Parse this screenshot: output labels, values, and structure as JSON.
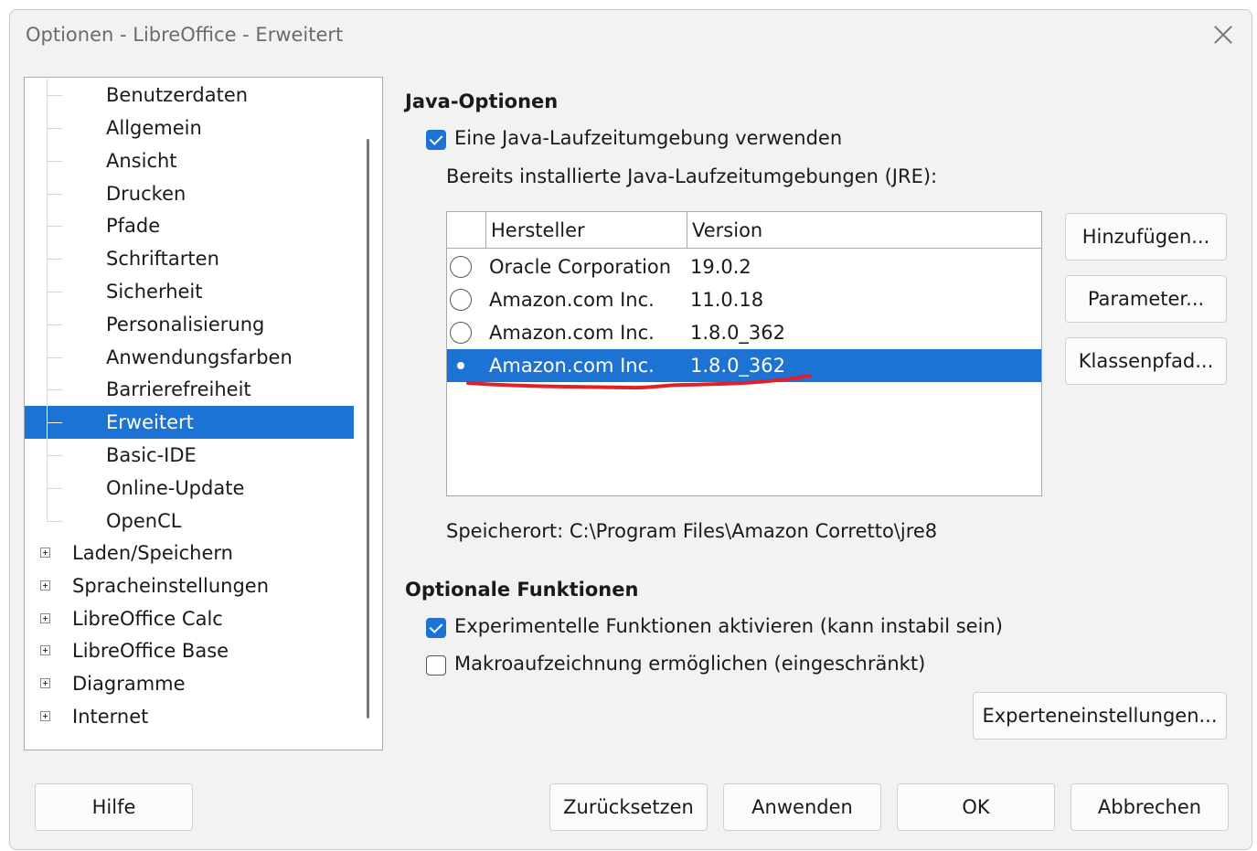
{
  "window": {
    "title": "Optionen - LibreOffice - Erweitert"
  },
  "tree": {
    "sub_items": [
      {
        "label": "Benutzerdaten"
      },
      {
        "label": "Allgemein"
      },
      {
        "label": "Ansicht"
      },
      {
        "label": "Drucken"
      },
      {
        "label": "Pfade"
      },
      {
        "label": "Schriftarten"
      },
      {
        "label": "Sicherheit"
      },
      {
        "label": "Personalisierung"
      },
      {
        "label": "Anwendungsfarben"
      },
      {
        "label": "Barrierefreiheit"
      },
      {
        "label": "Erweitert",
        "selected": true
      },
      {
        "label": "Basic-IDE"
      },
      {
        "label": "Online-Update"
      },
      {
        "label": "OpenCL"
      }
    ],
    "top_items": [
      {
        "label": "Laden/Speichern"
      },
      {
        "label": "Spracheinstellungen"
      },
      {
        "label": "LibreOffice Calc"
      },
      {
        "label": "LibreOffice Base"
      },
      {
        "label": "Diagramme"
      },
      {
        "label": "Internet"
      }
    ]
  },
  "java": {
    "section_title": "Java-Optionen",
    "use_jre_label": "Eine Java-Laufzeitumgebung verwenden",
    "use_jre_checked": true,
    "installed_label": "Bereits installierte Java-Laufzeitumgebungen (JRE):",
    "columns": [
      "Hersteller",
      "Version"
    ],
    "rows": [
      {
        "vendor": "Oracle Corporation",
        "version": "19.0.2",
        "selected": false
      },
      {
        "vendor": "Amazon.com Inc.",
        "version": "11.0.18",
        "selected": false
      },
      {
        "vendor": "Amazon.com Inc.",
        "version": "1.8.0_362",
        "selected": false
      },
      {
        "vendor": "Amazon.com Inc.",
        "version": "1.8.0_362",
        "selected": true
      }
    ],
    "buttons": {
      "add": "Hinzufügen...",
      "params": "Parameter...",
      "classpath": "Klassenpfad..."
    },
    "location": "Speicherort: C:\\Program Files\\Amazon Corretto\\jre8"
  },
  "optional": {
    "section_title": "Optionale Funktionen",
    "experimental_label": "Experimentelle Funktionen aktivieren (kann instabil sein)",
    "experimental_checked": true,
    "macro_label": "Makroaufzeichnung ermöglichen (eingeschränkt)",
    "macro_checked": false,
    "expert_button": "Experteneinstellungen..."
  },
  "footer": {
    "help": "Hilfe",
    "reset": "Zurücksetzen",
    "apply": "Anwenden",
    "ok": "OK",
    "cancel": "Abbrechen"
  },
  "colors": {
    "accent": "#1c73d3",
    "annotation": "#e0202a"
  }
}
